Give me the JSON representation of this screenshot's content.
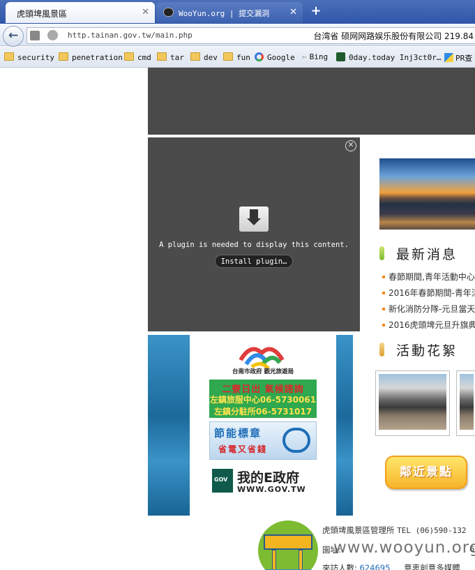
{
  "browser": {
    "tabs": [
      {
        "label": "虎頭埤風景區",
        "close": "✕"
      },
      {
        "label": "WooYun.org | 提交漏洞",
        "close": "✕"
      }
    ],
    "new_tab": "+",
    "back": "←",
    "url": "http.tainan.gov.tw/main.php",
    "url_right": "台湾省 硕网网路娱乐股份有限公司  219.84",
    "bookmarks": [
      "security",
      "penetration",
      "cmd",
      "tar",
      "dev",
      "fun",
      "Google",
      "Bing",
      "0day.today Inj3ct0r…",
      "PR查"
    ]
  },
  "plugin": {
    "close": "✕",
    "message": "A plugin is needed to display this content.",
    "install_label": "Install plugin…"
  },
  "ad": {
    "tourism_name": "台南市政府 觀光旅遊局",
    "weather_line1": "二寮日出 氣候諮詢",
    "weather_line2": "左鎮旅服中心06-5730061",
    "weather_line3": "左鎮分駐所06-5731017",
    "energy_line1": "節能標章",
    "energy_line2": "省電又省錢",
    "gov_title": "我的E政府",
    "gov_url": "WWW.GOV.TW"
  },
  "sidebar": {
    "news_title": "最新消息",
    "news_items": [
      "春節期間,青年活動中心",
      "2016年春節期間-青年活",
      "新化消防分隊-元旦當天",
      "2016虎頭埤元旦升旗典"
    ],
    "activity_title": "活動花絮",
    "nearby_label": "鄰近景點"
  },
  "footer": {
    "line1_org": "虎頭埤風景區管理所",
    "line1_tel": "TEL (06)590-132",
    "line2": "園址:",
    "line2_right": "6",
    "line3_label": "來訪人數:",
    "line3_count": "624695",
    "line3_right": "意衷創意多媒體"
  },
  "watermark": "www.wooyun.org",
  "colors": {
    "tabbar": "#2f55a8",
    "plugin_bg": "#4b4b4b",
    "news_bullet": "#f28b20",
    "nearby_btn": "#f7b42a"
  }
}
